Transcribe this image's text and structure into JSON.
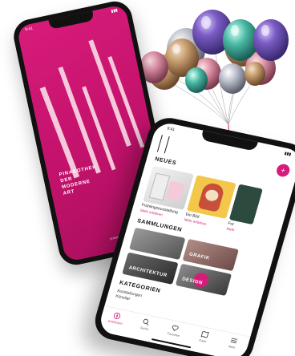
{
  "left_phone": {
    "status_time": "9:41",
    "museum_name": "PINAKOTHEK\nDER\nMODERNE\nART",
    "sponsor_text": "powered by ⓘ sponsor"
  },
  "right_phone": {
    "status_time": "9:41",
    "action_icon": "plus-icon",
    "sections": {
      "news": "NEUES",
      "collections": "SAMMLUNGEN",
      "categories": "KATEGORIEN"
    },
    "news_cards": [
      {
        "title": "Frühlings­ausstellung",
        "subtitle": "Mehr erfahren"
      },
      {
        "title": "Ein Bild",
        "subtitle": "Mehr erfahren"
      },
      {
        "title": "Fot",
        "subtitle": "Mehr"
      }
    ],
    "collection_tiles": [
      {
        "label": ""
      },
      {
        "label": "GRAFIK"
      },
      {
        "label": "ARCHITEKTUR"
      },
      {
        "label": "DESIGN"
      }
    ],
    "category_items": [
      "Ausstellungen",
      "Künstler"
    ],
    "tabs": [
      {
        "label": "Entdecken",
        "icon": "compass-icon"
      },
      {
        "label": "Suche",
        "icon": "search-icon"
      },
      {
        "label": "Favoriten",
        "icon": "heart-icon"
      },
      {
        "label": "Karte",
        "icon": "map-icon"
      },
      {
        "label": "Mehr",
        "icon": "menu-icon"
      }
    ]
  },
  "colors": {
    "brand_magenta": "#d81b7a",
    "phone_frame": "#111111",
    "background": "#ffffff"
  }
}
